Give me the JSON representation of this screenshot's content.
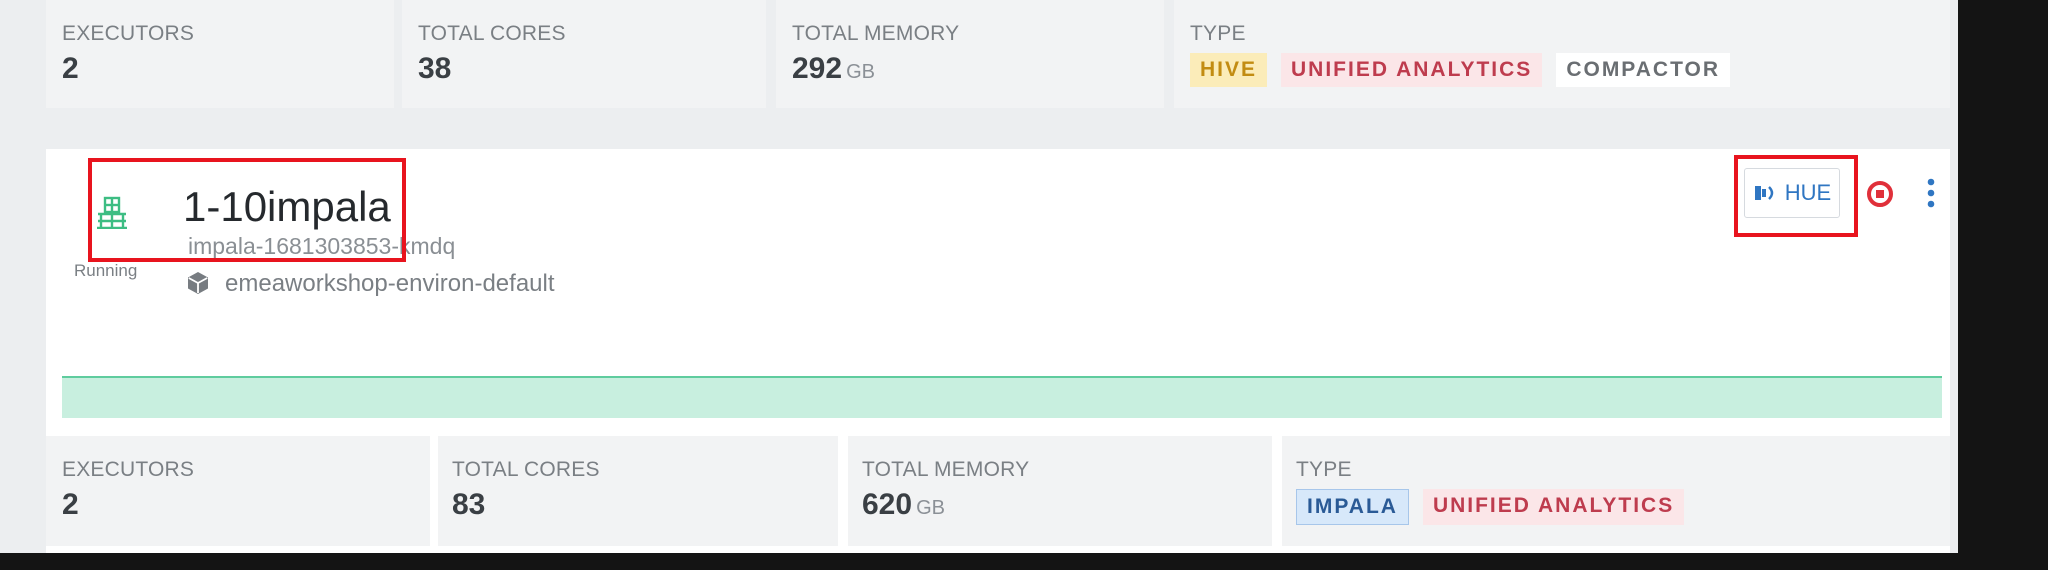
{
  "top_stats": {
    "executors": {
      "label": "EXECUTORS",
      "value": "2"
    },
    "total_cores": {
      "label": "TOTAL CORES",
      "value": "38"
    },
    "total_memory": {
      "label": "TOTAL MEMORY",
      "value": "292",
      "unit": "GB"
    },
    "type": {
      "label": "TYPE",
      "tags": [
        "HIVE",
        "UNIFIED ANALYTICS",
        "COMPACTOR"
      ]
    }
  },
  "cluster": {
    "title": "1-10impala",
    "id": "impala-1681303853-kmdq",
    "status": "Running",
    "environment": "emeaworkshop-environ-default",
    "hue_label": "HUE",
    "progress_fraction": 1.0
  },
  "bottom_stats": {
    "executors": {
      "label": "EXECUTORS",
      "value": "2"
    },
    "total_cores": {
      "label": "TOTAL CORES",
      "value": "83"
    },
    "total_memory": {
      "label": "TOTAL MEMORY",
      "value": "620",
      "unit": "GB"
    },
    "type": {
      "label": "TYPE",
      "tags": [
        "IMPALA",
        "UNIFIED ANALYTICS"
      ]
    }
  },
  "colors": {
    "status_running": "#3dbd83",
    "highlight": "#e8141e",
    "hue_blue": "#2f76c2",
    "stop_red": "#e0303a"
  },
  "icons": [
    "warehouse-icon",
    "environment-cube-icon",
    "hue-logo-icon",
    "stop-icon",
    "more-vertical-icon"
  ]
}
